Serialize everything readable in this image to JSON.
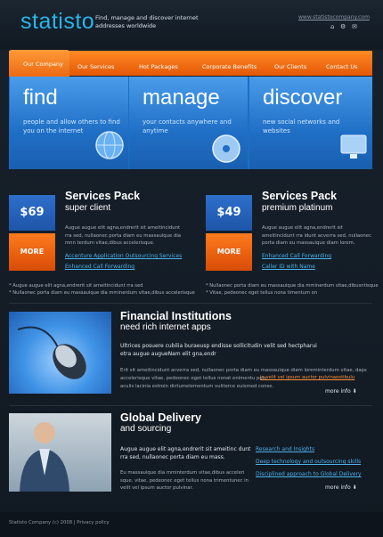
{
  "header": {
    "logo": "statisto",
    "tagline": "Find, manage and discover internet addresses worldwide",
    "url": "www.statistocompany.com",
    "icons": [
      "home-icon",
      "settings-icon",
      "mail-icon"
    ]
  },
  "nav": {
    "items": [
      "Our Company",
      "Our Services",
      "Hot Packages",
      "Corporate Benefits",
      "Our Clients",
      "Contact Us"
    ]
  },
  "hero": [
    {
      "title": "find",
      "text": "people and allow others to find you on the internet",
      "icon": "globe-icon"
    },
    {
      "title": "manage",
      "text": "your contacts anywhere and anytime",
      "icon": "disc-icon"
    },
    {
      "title": "discover",
      "text": "new social networks and websites",
      "icon": "monitor-icon"
    }
  ],
  "packs": [
    {
      "title": "Services Pack",
      "subtitle": "super client",
      "price": "$69",
      "more": "MORE",
      "text": "Augue augue elit agna,endrerit sit ameitincidunt rra sed, nullaonec porta diam eu massauique dia mnn terdum vitae,dibus accelerisque.",
      "links": [
        "Accenture Application Outsourcing Services",
        "Enhanced Call Forwarding"
      ]
    },
    {
      "title": "Services Pack",
      "subtitle": "premium platinum",
      "price": "$49",
      "more": "MORE",
      "text": "Augue augue elit agna,endrerit sit ameitincidunt rra idunt acverra sed, nullaonec porta diam eu massauique diam lorem.",
      "links": [
        "Enhanced Call Forwarding",
        "Caller ID with Name"
      ]
    }
  ],
  "notes": {
    "left": [
      "* Augue augue elit agna,endrerit sit ameitincidunt rra sed",
      "* Nullaonec porta diam eu massauique dia mminerdum vitae,dibus accelerisque"
    ],
    "right": [
      "* Nullaonec porta diam eu massauique dia mminerdum vitae,dibusntisque",
      "* Vitae, pedeonec eget tellus nona timentum on"
    ]
  },
  "financial": {
    "title": "Financial Institutions",
    "subtitle": "need rich internet apps",
    "lead": "Ultrices posuere cubilia buraeusp endisse sollicitudin velit sed hectpharui etra augue augueNam elit gna,endr",
    "body": "Erit sit ameitincidunt acverra sed, nullaonec porta diam eu massauique diam loreminterdum vitae, daps accelerisque vitae, pedeonec eget tellus nonat enimentu porc",
    "link": "in velit vel ipsum auctor pulvinaestibulu",
    "body2": "aculis lacinia estroin dictumelementum vuliterce euismod conse.",
    "more": "more info"
  },
  "global": {
    "title": "Global Delivery",
    "subtitle": "and sourcing",
    "lead": "Augue augue elit agna,endrerit sit ameitinc dunt rra sed, nullaonec porta diam eu mass.",
    "body": "Eu massauique dia mminterdum vitae,dibus acceleri sque. vitae, pedeonec eget tellus nona trimentunec in velit vel ipsum auctor pulvinar.",
    "links": [
      "Research and Insights",
      "Deep technology and outsourcing skills",
      "Disciplined approach to Global Delivery"
    ],
    "more": "more info"
  },
  "footer": {
    "text": "Statisto Company (c) 2008 | Privacy policy"
  }
}
